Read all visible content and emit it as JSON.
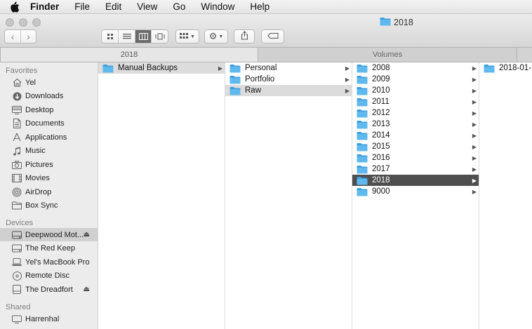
{
  "menubar": {
    "apple_icon": "apple-icon",
    "items": [
      "Finder",
      "File",
      "Edit",
      "View",
      "Go",
      "Window",
      "Help"
    ]
  },
  "window": {
    "title": "2018"
  },
  "toolbar": {
    "icons": [
      "back-icon",
      "forward-icon",
      "icon-view-icon",
      "list-view-icon",
      "column-view-icon",
      "cover-flow-icon",
      "arrange-icon",
      "action-gear-icon",
      "share-icon",
      "tag-icon"
    ],
    "active_view": "column"
  },
  "tabs": [
    {
      "label": "2018",
      "active": true
    },
    {
      "label": "Volumes",
      "active": false
    }
  ],
  "sidebar": {
    "favorites_header": "Favorites",
    "favorites": [
      {
        "label": "Yel",
        "icon": "home-icon"
      },
      {
        "label": "Downloads",
        "icon": "downloads-icon"
      },
      {
        "label": "Desktop",
        "icon": "desktop-icon"
      },
      {
        "label": "Documents",
        "icon": "documents-icon"
      },
      {
        "label": "Applications",
        "icon": "applications-icon"
      },
      {
        "label": "Music",
        "icon": "music-icon"
      },
      {
        "label": "Pictures",
        "icon": "pictures-icon"
      },
      {
        "label": "Movies",
        "icon": "movies-icon"
      },
      {
        "label": "AirDrop",
        "icon": "airdrop-icon"
      },
      {
        "label": "Box Sync",
        "icon": "folder-icon"
      }
    ],
    "devices_header": "Devices",
    "devices": [
      {
        "label": "Deepwood Mot...",
        "icon": "drive-icon",
        "eject": true,
        "selected": true
      },
      {
        "label": "The Red Keep",
        "icon": "drive-icon",
        "eject": false,
        "selected": false
      },
      {
        "label": "Yel's MacBook Pro",
        "icon": "laptop-icon",
        "eject": false,
        "selected": false
      },
      {
        "label": "Remote Disc",
        "icon": "disc-icon",
        "eject": false,
        "selected": false
      },
      {
        "label": "The Dreadfort",
        "icon": "drive-icon",
        "eject": true,
        "selected": false
      }
    ],
    "shared_header": "Shared",
    "shared": [
      {
        "label": "Harrenhal",
        "icon": "server-icon"
      }
    ]
  },
  "columns": [
    {
      "items": [
        {
          "label": "Manual Backups",
          "state": "path",
          "arrow": true
        }
      ]
    },
    {
      "items": [
        {
          "label": "Personal",
          "state": "",
          "arrow": true
        },
        {
          "label": "Portfolio",
          "state": "",
          "arrow": true
        },
        {
          "label": "Raw",
          "state": "path",
          "arrow": true
        }
      ]
    },
    {
      "items": [
        {
          "label": "2008",
          "state": "",
          "arrow": true
        },
        {
          "label": "2009",
          "state": "",
          "arrow": true
        },
        {
          "label": "2010",
          "state": "",
          "arrow": true
        },
        {
          "label": "2011",
          "state": "",
          "arrow": true
        },
        {
          "label": "2012",
          "state": "",
          "arrow": true
        },
        {
          "label": "2013",
          "state": "",
          "arrow": true
        },
        {
          "label": "2014",
          "state": "",
          "arrow": true
        },
        {
          "label": "2015",
          "state": "",
          "arrow": true
        },
        {
          "label": "2016",
          "state": "",
          "arrow": true
        },
        {
          "label": "2017",
          "state": "",
          "arrow": true
        },
        {
          "label": "2018",
          "state": "active",
          "arrow": true
        },
        {
          "label": "9000",
          "state": "",
          "arrow": true
        }
      ]
    },
    {
      "items": [
        {
          "label": "2018-01-",
          "state": "",
          "arrow": false
        }
      ]
    }
  ],
  "colors": {
    "folder": "#5fb8ee",
    "folder_dark": "#3f9edd",
    "selection": "#4f4f4f",
    "path_highlight": "#dcdcdc"
  }
}
